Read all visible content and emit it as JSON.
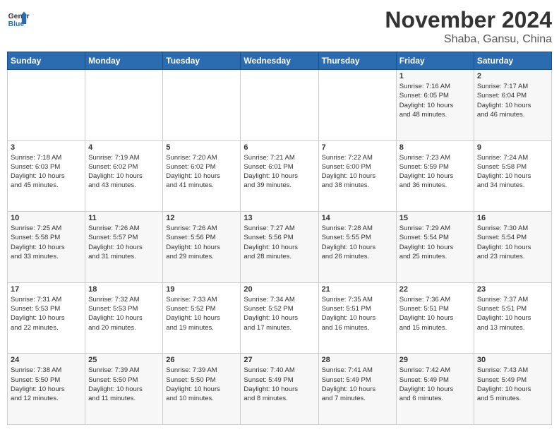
{
  "logo": {
    "line1": "General",
    "line2": "Blue"
  },
  "header": {
    "month": "November 2024",
    "location": "Shaba, Gansu, China"
  },
  "weekdays": [
    "Sunday",
    "Monday",
    "Tuesday",
    "Wednesday",
    "Thursday",
    "Friday",
    "Saturday"
  ],
  "weeks": [
    [
      {
        "day": "",
        "info": ""
      },
      {
        "day": "",
        "info": ""
      },
      {
        "day": "",
        "info": ""
      },
      {
        "day": "",
        "info": ""
      },
      {
        "day": "",
        "info": ""
      },
      {
        "day": "1",
        "info": "Sunrise: 7:16 AM\nSunset: 6:05 PM\nDaylight: 10 hours\nand 48 minutes."
      },
      {
        "day": "2",
        "info": "Sunrise: 7:17 AM\nSunset: 6:04 PM\nDaylight: 10 hours\nand 46 minutes."
      }
    ],
    [
      {
        "day": "3",
        "info": "Sunrise: 7:18 AM\nSunset: 6:03 PM\nDaylight: 10 hours\nand 45 minutes."
      },
      {
        "day": "4",
        "info": "Sunrise: 7:19 AM\nSunset: 6:02 PM\nDaylight: 10 hours\nand 43 minutes."
      },
      {
        "day": "5",
        "info": "Sunrise: 7:20 AM\nSunset: 6:02 PM\nDaylight: 10 hours\nand 41 minutes."
      },
      {
        "day": "6",
        "info": "Sunrise: 7:21 AM\nSunset: 6:01 PM\nDaylight: 10 hours\nand 39 minutes."
      },
      {
        "day": "7",
        "info": "Sunrise: 7:22 AM\nSunset: 6:00 PM\nDaylight: 10 hours\nand 38 minutes."
      },
      {
        "day": "8",
        "info": "Sunrise: 7:23 AM\nSunset: 5:59 PM\nDaylight: 10 hours\nand 36 minutes."
      },
      {
        "day": "9",
        "info": "Sunrise: 7:24 AM\nSunset: 5:58 PM\nDaylight: 10 hours\nand 34 minutes."
      }
    ],
    [
      {
        "day": "10",
        "info": "Sunrise: 7:25 AM\nSunset: 5:58 PM\nDaylight: 10 hours\nand 33 minutes."
      },
      {
        "day": "11",
        "info": "Sunrise: 7:26 AM\nSunset: 5:57 PM\nDaylight: 10 hours\nand 31 minutes."
      },
      {
        "day": "12",
        "info": "Sunrise: 7:26 AM\nSunset: 5:56 PM\nDaylight: 10 hours\nand 29 minutes."
      },
      {
        "day": "13",
        "info": "Sunrise: 7:27 AM\nSunset: 5:56 PM\nDaylight: 10 hours\nand 28 minutes."
      },
      {
        "day": "14",
        "info": "Sunrise: 7:28 AM\nSunset: 5:55 PM\nDaylight: 10 hours\nand 26 minutes."
      },
      {
        "day": "15",
        "info": "Sunrise: 7:29 AM\nSunset: 5:54 PM\nDaylight: 10 hours\nand 25 minutes."
      },
      {
        "day": "16",
        "info": "Sunrise: 7:30 AM\nSunset: 5:54 PM\nDaylight: 10 hours\nand 23 minutes."
      }
    ],
    [
      {
        "day": "17",
        "info": "Sunrise: 7:31 AM\nSunset: 5:53 PM\nDaylight: 10 hours\nand 22 minutes."
      },
      {
        "day": "18",
        "info": "Sunrise: 7:32 AM\nSunset: 5:53 PM\nDaylight: 10 hours\nand 20 minutes."
      },
      {
        "day": "19",
        "info": "Sunrise: 7:33 AM\nSunset: 5:52 PM\nDaylight: 10 hours\nand 19 minutes."
      },
      {
        "day": "20",
        "info": "Sunrise: 7:34 AM\nSunset: 5:52 PM\nDaylight: 10 hours\nand 17 minutes."
      },
      {
        "day": "21",
        "info": "Sunrise: 7:35 AM\nSunset: 5:51 PM\nDaylight: 10 hours\nand 16 minutes."
      },
      {
        "day": "22",
        "info": "Sunrise: 7:36 AM\nSunset: 5:51 PM\nDaylight: 10 hours\nand 15 minutes."
      },
      {
        "day": "23",
        "info": "Sunrise: 7:37 AM\nSunset: 5:51 PM\nDaylight: 10 hours\nand 13 minutes."
      }
    ],
    [
      {
        "day": "24",
        "info": "Sunrise: 7:38 AM\nSunset: 5:50 PM\nDaylight: 10 hours\nand 12 minutes."
      },
      {
        "day": "25",
        "info": "Sunrise: 7:39 AM\nSunset: 5:50 PM\nDaylight: 10 hours\nand 11 minutes."
      },
      {
        "day": "26",
        "info": "Sunrise: 7:39 AM\nSunset: 5:50 PM\nDaylight: 10 hours\nand 10 minutes."
      },
      {
        "day": "27",
        "info": "Sunrise: 7:40 AM\nSunset: 5:49 PM\nDaylight: 10 hours\nand 8 minutes."
      },
      {
        "day": "28",
        "info": "Sunrise: 7:41 AM\nSunset: 5:49 PM\nDaylight: 10 hours\nand 7 minutes."
      },
      {
        "day": "29",
        "info": "Sunrise: 7:42 AM\nSunset: 5:49 PM\nDaylight: 10 hours\nand 6 minutes."
      },
      {
        "day": "30",
        "info": "Sunrise: 7:43 AM\nSunset: 5:49 PM\nDaylight: 10 hours\nand 5 minutes."
      }
    ]
  ]
}
